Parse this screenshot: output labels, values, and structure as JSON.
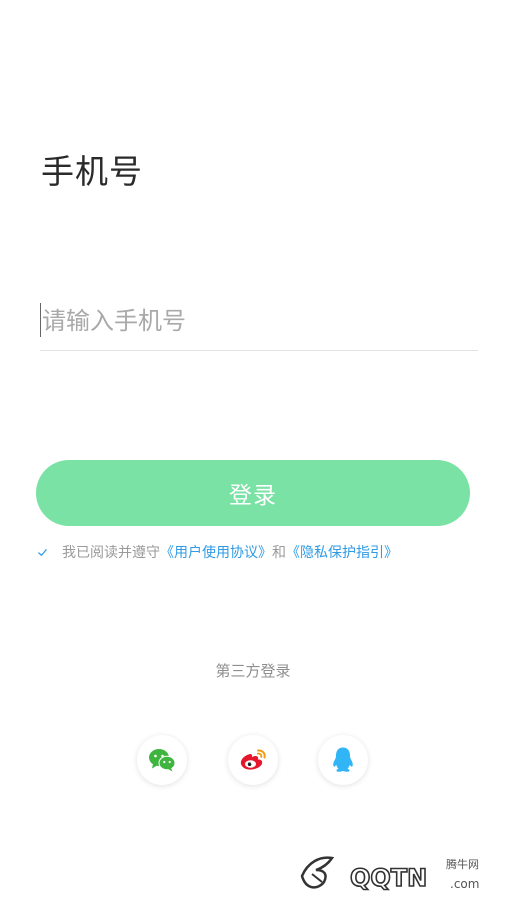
{
  "page": {
    "title": "手机号"
  },
  "phone_input": {
    "placeholder": "请输入手机号",
    "value": ""
  },
  "login_button": {
    "label": "登录"
  },
  "agreement": {
    "prefix": "我已阅读并遵守",
    "user_agreement": "《用户使用协议》",
    "and": "和",
    "privacy_guide": "《隐私保护指引》"
  },
  "third_party": {
    "label": "第三方登录",
    "options": [
      "wechat-icon",
      "weibo-icon",
      "qq-icon"
    ]
  },
  "watermark": {
    "brand": "腾牛网"
  },
  "colors": {
    "accent": "#7ae2a4",
    "link": "#2f9be6",
    "wechat": "#3fb53f",
    "weibo": "#e6162d",
    "qq": "#31b5f6"
  }
}
